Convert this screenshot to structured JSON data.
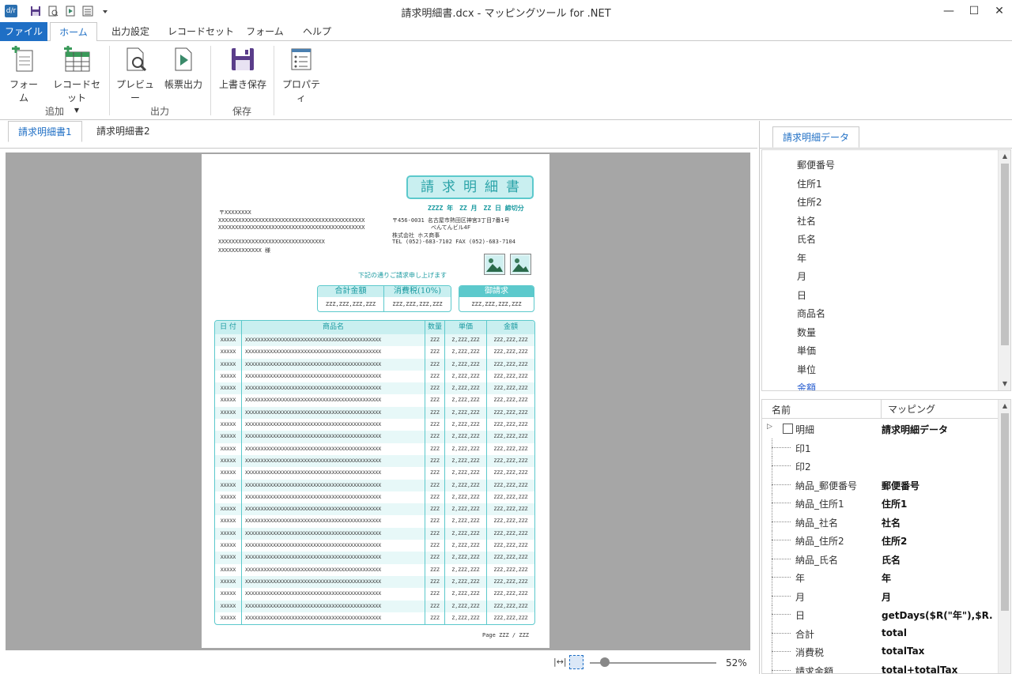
{
  "window": {
    "title": "請求明細書.dcx  -  マッピングツール for .NET",
    "minimize": "—",
    "maximize": "☐",
    "close": "✕"
  },
  "app_icon": {
    "label": "d/r"
  },
  "menu": {
    "tabs": [
      "ファイル",
      "ホーム",
      "出力設定",
      "レコードセット",
      "フォーム",
      "ヘルプ"
    ]
  },
  "ribbon": {
    "form_button": "フォーム",
    "recordset_button": "レコードセット",
    "preview_button": "プレビュー",
    "print_button": "帳票出力",
    "save_button": "上書き保存",
    "property_button": "プロパティ",
    "group_add": "追加",
    "group_output": "出力",
    "group_save": "保存"
  },
  "doc_tabs": [
    "請求明細書1",
    "請求明細書2"
  ],
  "zoom": {
    "value": 0.52,
    "label": "52%"
  },
  "right_panel": {
    "tab": "請求明細データ",
    "fields": [
      "郵便番号",
      "住所1",
      "住所2",
      "社名",
      "氏名",
      "年",
      "月",
      "日",
      "商品名",
      "数量",
      "単価",
      "単位",
      "金額"
    ],
    "mapping_headers": {
      "name": "名前",
      "mapping": "マッピング"
    },
    "mapping_rows": [
      {
        "name": "明細",
        "mapping": "請求明細データ"
      },
      {
        "name": "印1",
        "mapping": ""
      },
      {
        "name": "印2",
        "mapping": ""
      },
      {
        "name": "納品_郵便番号",
        "mapping": "郵便番号"
      },
      {
        "name": "納品_住所1",
        "mapping": "住所1"
      },
      {
        "name": "納品_社名",
        "mapping": "社名"
      },
      {
        "name": "納品_住所2",
        "mapping": "住所2"
      },
      {
        "name": "納品_氏名",
        "mapping": "氏名"
      },
      {
        "name": "年",
        "mapping": "年"
      },
      {
        "name": "月",
        "mapping": "月"
      },
      {
        "name": "日",
        "mapping": "getDays($R(\"年\"),$R..."
      },
      {
        "name": "合計",
        "mapping": "total"
      },
      {
        "name": "消費税",
        "mapping": "totalTax"
      },
      {
        "name": "請求金額",
        "mapping": "total+totalTax"
      }
    ]
  },
  "invoice": {
    "title": "請求明細書",
    "date_line": "ZZZZ 年　ZZ 月　ZZ 日 締切分",
    "postal": "〒XXXXXXXX",
    "addr1": "XXXXXXXXXXXXXXXXXXXXXXXXXXXXXXXXXXXXXXXXXXXX",
    "addr2": "XXXXXXXXXXXXXXXXXXXXXXXXXXXXXXXXXXXXXXXXXXXX",
    "company": "XXXXXXXXXXXXXXXXXXXXXXXXXXXXXXXX",
    "person": "XXXXXXXXXXXXX 様",
    "sender_addr": "〒456-0031 名古屋市熱田区神宮3丁目7番1号",
    "sender_bldg": "べんてんビル4F",
    "sender_company": "株式会社 ホス商事",
    "sender_tel": "TEL (052)-683-7102 FAX (052)-683-7104",
    "message": "下記の通りご請求申し上げます",
    "total_label": "合計金額",
    "tax_label": "消費税(10%)",
    "billing_label": "御請求",
    "total_value": "ZZZ,ZZZ,ZZZ,ZZZ",
    "tax_value": "ZZZ,ZZZ,ZZZ,ZZZ",
    "billing_value": "ZZZ,ZZZ,ZZZ,ZZZ",
    "columns": [
      "日 付",
      "商品名",
      "数量",
      "単価",
      "金額"
    ],
    "row": [
      "XXXXX",
      "XXXXXXXXXXXXXXXXXXXXXXXXXXXXXXXXXXXXXXXXXXXX",
      "ZZZ",
      "Z,ZZZ,ZZZ",
      "ZZZ,ZZZ,ZZZ"
    ],
    "row_count": 24,
    "page": "Page ZZZ / ZZZ"
  }
}
